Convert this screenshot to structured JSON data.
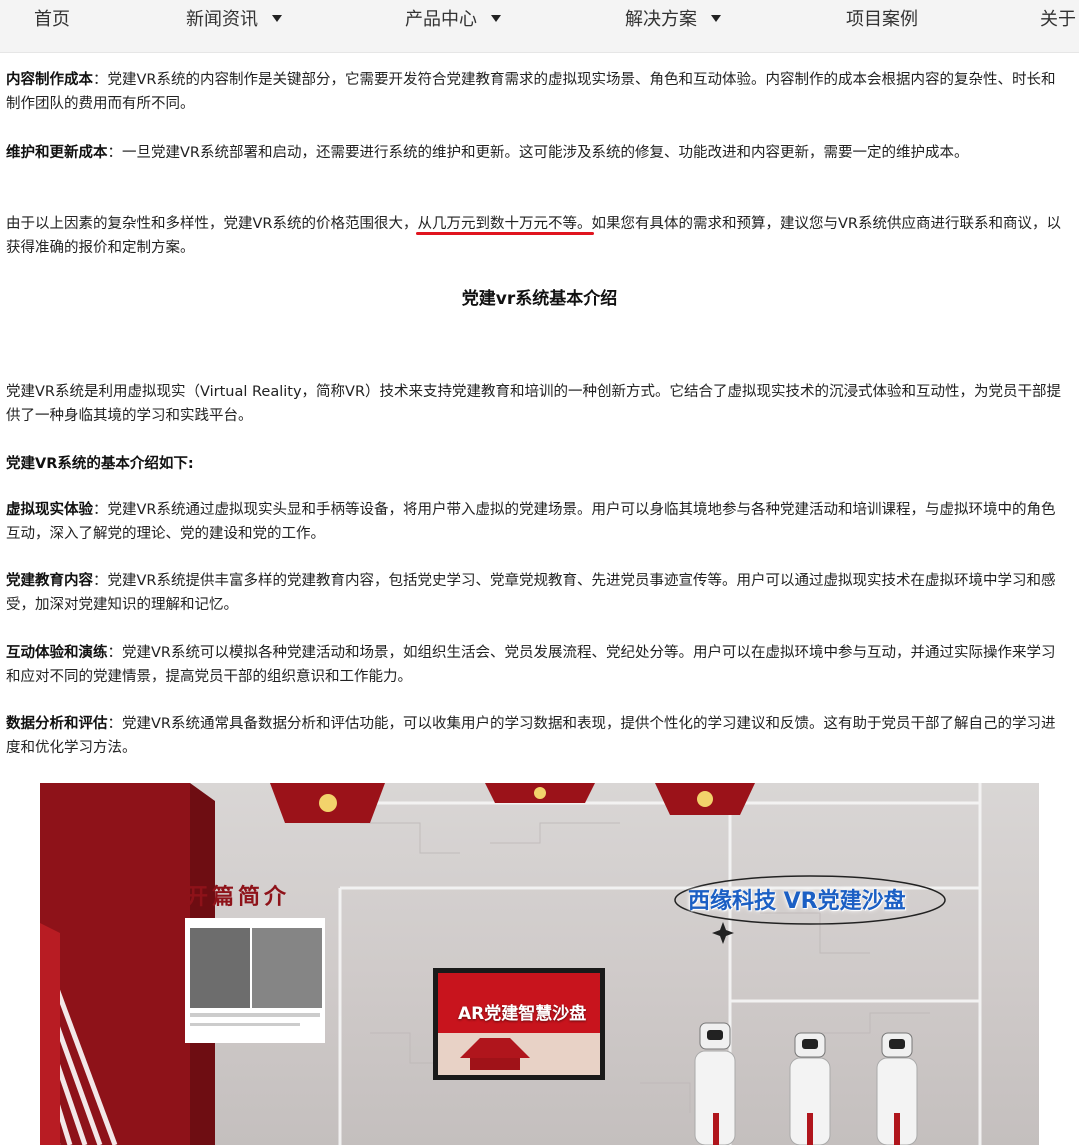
{
  "nav": {
    "items": [
      {
        "label": "首页",
        "dropdown": false
      },
      {
        "label": "新闻资讯",
        "dropdown": true
      },
      {
        "label": "产品中心",
        "dropdown": true
      },
      {
        "label": "解决方案",
        "dropdown": true
      },
      {
        "label": "项目案例",
        "dropdown": false
      },
      {
        "label": "关于",
        "dropdown": false
      }
    ]
  },
  "article": {
    "p1": {
      "term": "内容制作成本",
      "text": "：党建VR系统的内容制作是关键部分，它需要开发符合党建教育需求的虚拟现实场景、角色和互动体验。内容制作的成本会根据内容的复杂性、时长和制作团队的费用而有所不同。"
    },
    "p2": {
      "term": "维护和更新成本",
      "text": "：一旦党建VR系统部署和启动，还需要进行系统的维护和更新。这可能涉及系统的修复、功能改进和内容更新，需要一定的维护成本。"
    },
    "p3": {
      "before": "由于以上因素的复杂性和多样性，党建VR系统的价格范围很大，",
      "highlight": "从几万元到数十万元不等。",
      "after": "如果您有具体的需求和预算，建议您与VR系统供应商进行联系和商议，以获得准确的报价和定制方案。"
    },
    "section_title": "党建vr系统基本介绍",
    "intro": "党建VR系统是利用虚拟现实（Virtual Reality，简称VR）技术来支持党建教育和培训的一种创新方式。它结合了虚拟现实技术的沉浸式体验和互动性，为党员干部提供了一种身临其境的学习和实践平台。",
    "list_heading": "党建VR系统的基本介绍如下:",
    "items": [
      {
        "term": "虚拟现实体验",
        "text": "：党建VR系统通过虚拟现实头显和手柄等设备，将用户带入虚拟的党建场景。用户可以身临其境地参与各种党建活动和培训课程，与虚拟环境中的角色互动，深入了解党的理论、党的建设和党的工作。"
      },
      {
        "term": "党建教育内容",
        "text": "：党建VR系统提供丰富多样的党建教育内容，包括党史学习、党章党规教育、先进党员事迹宣传等。用户可以通过虚拟现实技术在虚拟环境中学习和感受，加深对党建知识的理解和记忆。"
      },
      {
        "term": "互动体验和演练",
        "text": "：党建VR系统可以模拟各种党建活动和场景，如组织生活会、党员发展流程、党纪处分等。用户可以在虚拟环境中参与互动，并通过实际操作来学习和应对不同的党建情景，提高党员干部的组织意识和工作能力。"
      },
      {
        "term": "数据分析和评估",
        "text": "：党建VR系统通常具备数据分析和评估功能，可以收集用户的学习数据和表现，提供个性化的学习建议和反馈。这有助于党员干部了解自己的学习进度和优化学习方法。"
      }
    ]
  },
  "photo": {
    "overlay_title": "西缘科技 VR党建沙盘",
    "board_title": "开篇简介",
    "screen_title": "AR党建智慧沙盘"
  },
  "colors": {
    "highlight_underline": "#e0141e",
    "party_red": "#9b1219",
    "overlay_blue": "#1b5fc4"
  }
}
